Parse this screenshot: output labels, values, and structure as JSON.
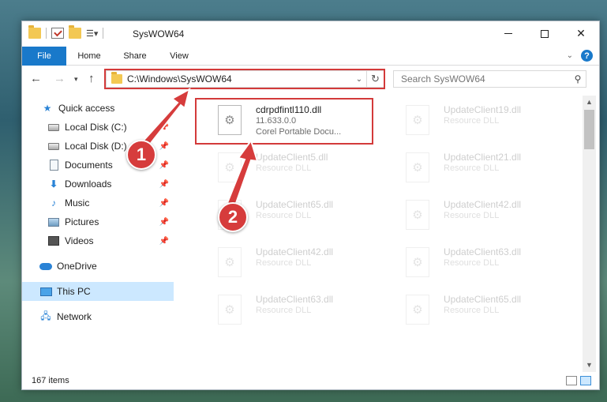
{
  "window": {
    "title": "SysWOW64",
    "controls": {
      "minimize": "minimize",
      "maximize": "maximize",
      "close": "✕"
    }
  },
  "ribbon": {
    "tabs": [
      "File",
      "Home",
      "Share",
      "View"
    ]
  },
  "navigation": {
    "address": "C:\\Windows\\SysWOW64",
    "search_placeholder": "Search SysWOW64"
  },
  "sidebar": {
    "items": [
      {
        "label": "Quick access",
        "icon": "star-icon",
        "pinned": false
      },
      {
        "label": "Local Disk (C:)",
        "icon": "drive-icon",
        "pinned": true
      },
      {
        "label": "Local Disk (D:)",
        "icon": "drive-icon",
        "pinned": true
      },
      {
        "label": "Documents",
        "icon": "document-icon",
        "pinned": true
      },
      {
        "label": "Downloads",
        "icon": "download-icon",
        "pinned": true
      },
      {
        "label": "Music",
        "icon": "music-icon",
        "pinned": true
      },
      {
        "label": "Pictures",
        "icon": "pictures-icon",
        "pinned": true
      },
      {
        "label": "Videos",
        "icon": "videos-icon",
        "pinned": true
      },
      {
        "label": "OneDrive",
        "icon": "cloud-icon",
        "pinned": false
      },
      {
        "label": "This PC",
        "icon": "computer-icon",
        "pinned": false,
        "selected": true
      },
      {
        "label": "Network",
        "icon": "network-icon",
        "pinned": false
      }
    ]
  },
  "files": [
    {
      "name": "cdrpdfintl110.dll",
      "line2": "11.633.0.0",
      "line3": "Corel Portable Docu...",
      "highlighted": true
    },
    {
      "name": "UpdateClient19.dll",
      "line2": "Resource DLL"
    },
    {
      "name": "UpdateClient5.dll",
      "line2": "Resource DLL"
    },
    {
      "name": "UpdateClient21.dll",
      "line2": "Resource DLL"
    },
    {
      "name": "UpdateClient65.dll",
      "line2": "Resource DLL"
    },
    {
      "name": "UpdateClient42.dll",
      "line2": "Resource DLL"
    },
    {
      "name": "UpdateClient42.dll",
      "line2": "Resource DLL"
    },
    {
      "name": "UpdateClient63.dll",
      "line2": "Resource DLL"
    },
    {
      "name": "UpdateClient63.dll",
      "line2": "Resource DLL"
    },
    {
      "name": "UpdateClient65.dll",
      "line2": "Resource DLL"
    }
  ],
  "status": {
    "item_count": "167 items"
  },
  "annotations": {
    "step1": "1",
    "step2": "2",
    "highlight_color": "#d33a3a"
  },
  "colors": {
    "accent": "#1979ca",
    "selection": "#cce8ff"
  }
}
